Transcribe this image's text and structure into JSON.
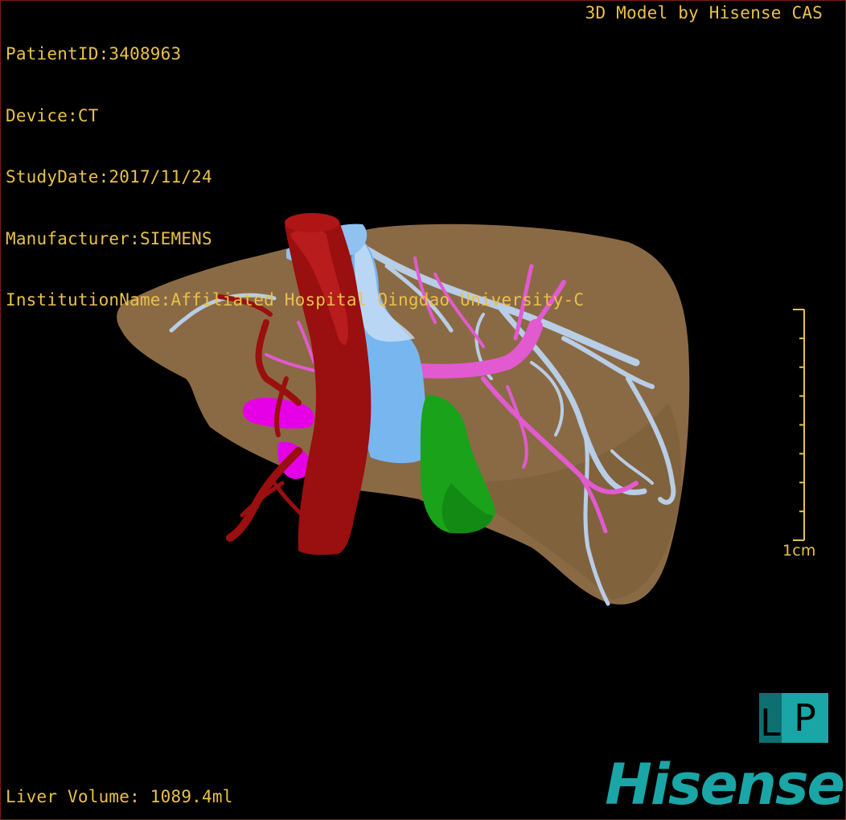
{
  "info": {
    "patient_id": "PatientID:3408963",
    "device": "Device:CT",
    "study_date": "StudyDate:2017/11/24",
    "manufacturer": "Manufacturer:SIEMENS",
    "institution": "InstitutionName:Affiliated Hospital Qingdao University-C"
  },
  "credit": "3D Model by Hisense CAS",
  "liver_volume": "Liver Volume: 1089.4ml",
  "scale_bar": {
    "label": "1cm",
    "ticks": 9
  },
  "logo": {
    "left": "L",
    "right": "P"
  },
  "brand": "Hisense",
  "colors": {
    "text": "#e8c14a",
    "liver": "#8a6a44",
    "aorta": "#9a0f0f",
    "portal_vein": "#b8cde6",
    "hepatic_vein": "#e25ad0",
    "ivc": "#78b6f0",
    "gallbladder": "#1aa21a",
    "accent_magenta": "#e600e6",
    "brand": "#1aa6a6"
  }
}
